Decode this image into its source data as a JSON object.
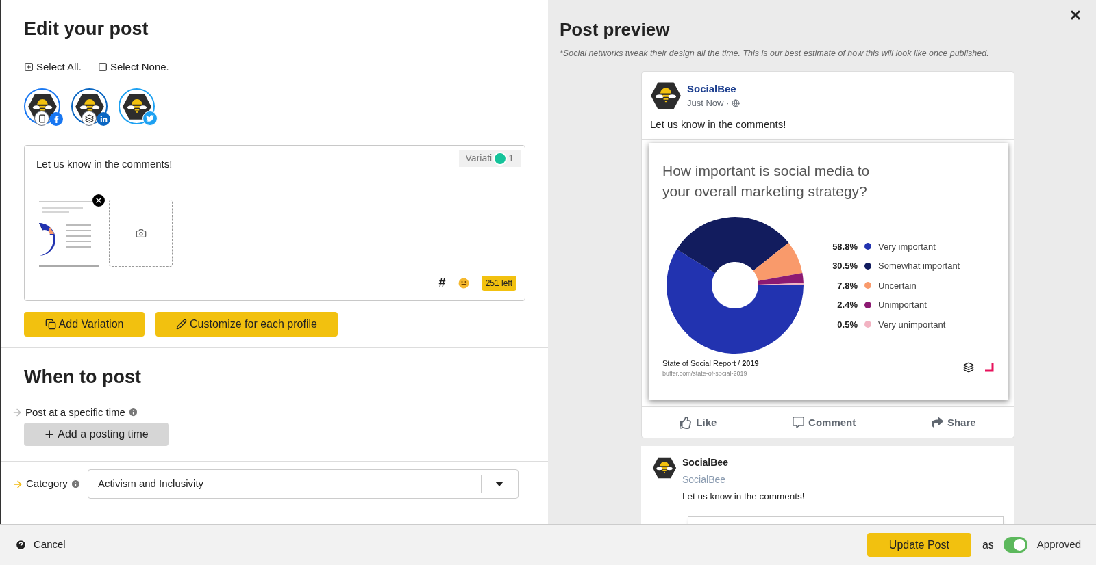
{
  "edit_panel": {
    "title": "Edit your post",
    "select_all": "Select All.",
    "select_none": "Select None.",
    "profiles": [
      {
        "kind": "facebook",
        "selected": true
      },
      {
        "kind": "linkedin",
        "selected": true
      },
      {
        "kind": "twitter",
        "selected": true
      }
    ],
    "editor": {
      "text": "Let us know in the comments!",
      "variation_label": "Variati",
      "variation_number": "1",
      "hashtag": "#",
      "char_count": "251 left"
    },
    "buttons": [
      {
        "kind": "variation",
        "label": "Add Variation"
      },
      {
        "kind": "customize",
        "label": "Customize for each profile"
      }
    ]
  },
  "when_to_post": {
    "title": "When to post",
    "label": "Post at a specific time",
    "button": "Add a posting time"
  },
  "category": {
    "label": "Category",
    "value": "Activism and Inclusivity"
  },
  "preview": {
    "title": "Post preview",
    "note": "*Social networks tweak their design all the time. This is our best estimate of how this will look like once published.",
    "facebook_card": {
      "name": "SocialBee",
      "time": "Just Now ·",
      "text": "Let us know in the comments!",
      "image": {
        "chart_data": {
          "type": "donut",
          "title": "How important is social media to your overall marketing strategy?",
          "categories": [
            "Very important",
            "Somewhat important",
            "Uncertain",
            "Unimportant",
            "Very unimportant"
          ],
          "values": [
            58.8,
            30.5,
            7.8,
            2.4,
            0.5
          ],
          "value_labels": [
            "58.8%",
            "30.5%",
            "7.8%",
            "2.4%",
            "0.5%"
          ],
          "colors": [
            "#2233b0",
            "#121c5e",
            "#f99a6b",
            "#8c1a72",
            "#f2b3c2"
          ],
          "legend": true
        },
        "source": "State of Social Report / **2019**",
        "url": "buffer.com/state-of-social-2019"
      },
      "actions": [
        "Like",
        "Comment",
        "Share"
      ]
    },
    "second_card": {
      "name": "SocialBee",
      "handle": "SocialBee",
      "text": "Let us know in the comments!"
    }
  },
  "footer": {
    "cancel": "Cancel",
    "update": "Update Post",
    "as": "as",
    "status": {
      "label": "Approved",
      "on": true
    }
  }
}
